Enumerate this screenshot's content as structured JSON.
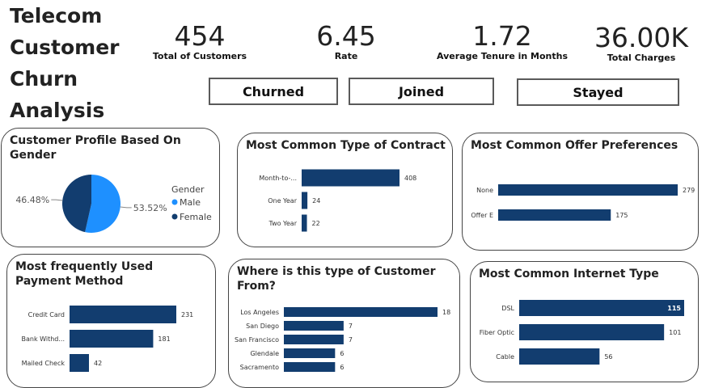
{
  "title": "Telecom Customer Churn Analysis",
  "kpis": [
    {
      "value": "454",
      "label": "Total of Customers"
    },
    {
      "value": "6.45",
      "label": "Rate"
    },
    {
      "value": "1.72",
      "label": "Average  Tenure in Months"
    },
    {
      "value": "36.00K",
      "label": "Total Charges"
    }
  ],
  "buttons": [
    "Churned",
    "Joined",
    "Stayed"
  ],
  "colors": {
    "bar": "#123d6f",
    "male": "#1e90ff",
    "female": "#123d6f"
  },
  "chart_data": [
    {
      "id": "gender",
      "type": "pie",
      "title": "Customer Profile Based On Gender",
      "legend_title": "Gender",
      "labels": [
        "Male",
        "Female"
      ],
      "values": [
        53.52,
        46.48
      ],
      "value_labels": [
        "53.52%",
        "46.48%"
      ]
    },
    {
      "id": "contract",
      "type": "bar",
      "title": "Most Common Type of Contract",
      "categories": [
        "Month-to-...",
        "One Year",
        "Two Year"
      ],
      "values": [
        408,
        24,
        22
      ]
    },
    {
      "id": "offer",
      "type": "bar",
      "title": "Most Common Offer Preferences",
      "categories": [
        "None",
        "Offer E"
      ],
      "values": [
        279,
        175
      ]
    },
    {
      "id": "payment",
      "type": "bar",
      "title": "Most frequently Used Payment Method",
      "categories": [
        "Credit Card",
        "Bank Withd...",
        "Mailed Check"
      ],
      "values": [
        231,
        181,
        42
      ]
    },
    {
      "id": "city",
      "type": "bar",
      "title": "Where is this type of Customer From?",
      "categories": [
        "Los Angeles",
        "San Diego",
        "San Francisco",
        "Glendale",
        "Sacramento"
      ],
      "values": [
        18,
        7,
        7,
        6,
        6
      ]
    },
    {
      "id": "internet",
      "type": "bar",
      "title": "Most Common Internet Type",
      "categories": [
        "DSL",
        "Fiber Optic",
        "Cable"
      ],
      "values": [
        115,
        101,
        56
      ]
    }
  ]
}
